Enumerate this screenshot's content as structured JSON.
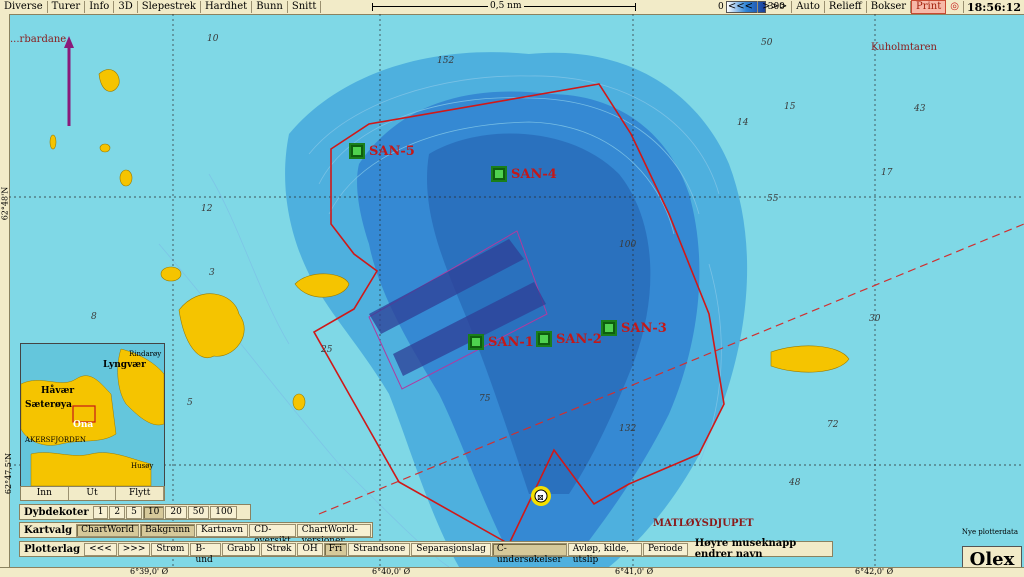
{
  "toolbar": {
    "menu": [
      "Diverse",
      "Turer",
      "Info",
      "3D",
      "Slepestrek",
      "Hardhet",
      "Bunn",
      "Snitt"
    ],
    "scale_label": "0,5 nm",
    "depth_min": "0",
    "depth_max": "300",
    "right": [
      "<<<",
      ">>>",
      "Auto",
      "Relieff",
      "Bokser"
    ],
    "print": "Print",
    "time": "18:56:12"
  },
  "rulers": {
    "lat": [
      "62°48'N",
      "62°47,5'N"
    ],
    "lon": [
      "6°39,0' Ø",
      "6°40,0' Ø",
      "6°41,0' Ø",
      "6°42,0' Ø"
    ]
  },
  "places": {
    "northwest": "...rbardane",
    "northeast": "Kuholmtaren",
    "deep": "MATLØYSDJUPET"
  },
  "sites": [
    "SAN-1",
    "SAN-2",
    "SAN-3",
    "SAN-4",
    "SAN-5"
  ],
  "depths": [
    "10",
    "152",
    "100",
    "50",
    "12",
    "15",
    "14",
    "43",
    "17",
    "55",
    "30",
    "72",
    "48",
    "132",
    "75",
    "25",
    "8",
    "5",
    "3",
    "152",
    "105"
  ],
  "inset": {
    "labels": [
      "Håvær",
      "Lyngvær",
      "Sæterøya",
      "Ona",
      "AKERSFJORDEN",
      "Rindarøy",
      "Husøy"
    ],
    "buttons": [
      "Inn",
      "Ut",
      "Flytt"
    ]
  },
  "dybdekoter": {
    "title": "Dybdekoter",
    "values": [
      "1",
      "2",
      "5",
      "10",
      "20",
      "50",
      "100"
    ],
    "selected": "10"
  },
  "kartvalg": {
    "title": "Kartvalg",
    "items": [
      "ChartWorld",
      "Bakgrunn",
      "Kartnavn",
      "CD-oversikt",
      "ChartWorld-versjoner"
    ],
    "active": [
      "ChartWorld",
      "Bakgrunn"
    ]
  },
  "plotterlag": {
    "title": "Plotterlag",
    "items": [
      "<<<",
      ">>>",
      "Strøm",
      "B-und",
      "Grabb",
      "Strøk",
      "OH",
      "Fri",
      "Strandsone",
      "Separasjonslag",
      "C-undersøkelser",
      "Avløp, kilde, utslip",
      "Periode"
    ],
    "active": [
      "Fri",
      "C-undersøkelser"
    ],
    "hint": "Høyre museknapp endrer navn"
  },
  "footer": {
    "nyeplott": "Nye plotterdata",
    "logo": "Olex"
  },
  "colors": {
    "shallow": "#7fd8e6",
    "mid": "#3aa6d8",
    "deep": "#2a6fc0",
    "land": "#f5c400",
    "polygon": "#d01818",
    "site": "#4fd24f",
    "zone": "#2f3f95"
  }
}
